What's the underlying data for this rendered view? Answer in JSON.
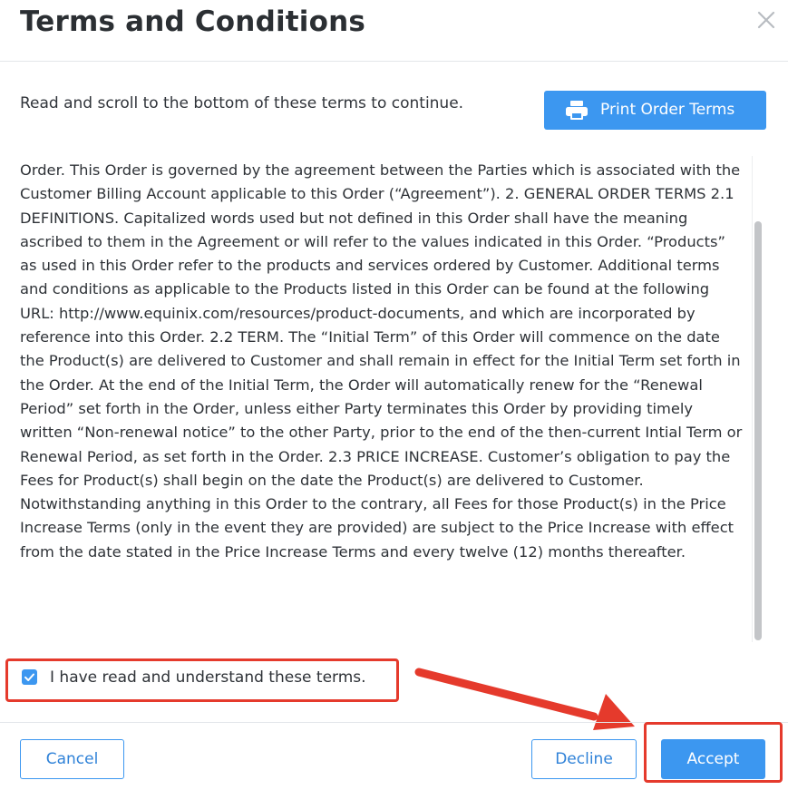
{
  "dialog": {
    "title": "Terms and Conditions",
    "close_icon": "close-icon"
  },
  "intro": {
    "text": "Read and scroll to the bottom of these terms to continue."
  },
  "print_button": {
    "label": "Print Order Terms",
    "icon": "printer-icon"
  },
  "terms": {
    "text": "Order. This Order is governed by the agreement between the Parties which is associated with the Customer Billing Account applicable to this Order (“Agreement”). 2. GENERAL ORDER TERMS 2.1 DEFINITIONS. Capitalized words used but not defined in this Order shall have the meaning ascribed to them in the Agreement or will refer to the values indicated in this Order. “Products” as used in this Order refer to the products and services ordered by Customer. Additional terms and conditions as applicable to the Products listed in this Order can be found at the following URL: http://www.equinix.com/resources/product-documents, and which are incorporated by reference into this Order. 2.2 TERM. The “Initial Term” of this Order will commence on the date the Product(s) are delivered to Customer and shall remain in effect for the Initial Term set forth in the Order. At the end of the Initial Term, the Order will automatically renew for the “Renewal Period” set forth in the Order, unless either Party terminates this Order by providing timely written “Non-renewal notice” to the other Party, prior to the end of the then-current Intial Term or Renewal Period, as set forth in the Order. 2.3 PRICE INCREASE. Customer’s obligation to pay the Fees for Product(s) shall begin on the date the Product(s) are delivered to Customer. Notwithstanding anything in this Order to the contrary, all Fees for those Product(s) in the Price Increase Terms (only in the event they are provided) are subject to the Price Increase with effect from the date stated in the Price Increase Terms and every twelve (12) months thereafter."
  },
  "acknowledge": {
    "label": "I have read and understand these terms.",
    "checked": true
  },
  "footer": {
    "cancel_label": "Cancel",
    "decline_label": "Decline",
    "accept_label": "Accept"
  },
  "colors": {
    "primary": "#3c97f0",
    "annotation_red": "#e53a2c"
  }
}
